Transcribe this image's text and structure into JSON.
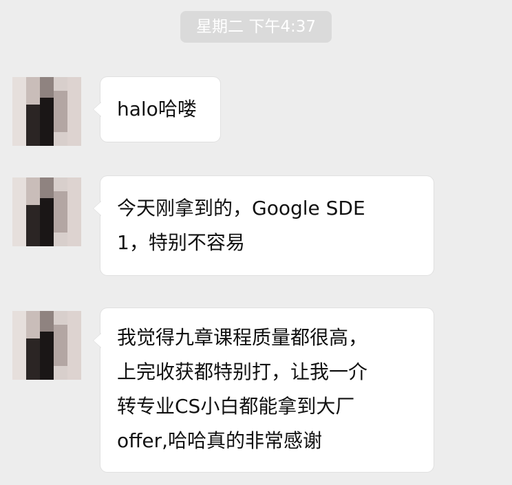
{
  "chat": {
    "timestamp": "星期二 下午4:37",
    "messages": [
      {
        "lines": [
          "halo哈喽"
        ]
      },
      {
        "lines": [
          "今天刚拿到的，Google SDE",
          "1，特别不容易"
        ]
      },
      {
        "lines": [
          "我觉得九章课程质量都很高，",
          "上完收获都特别打，让我一介",
          "转专业CS小白都能拿到大厂",
          "offer,哈哈真的非常感谢"
        ]
      }
    ]
  },
  "colors": {
    "background": "#ededed",
    "bubble": "#ffffff",
    "timestamp_bg": "#dadada",
    "text": "#111111"
  }
}
